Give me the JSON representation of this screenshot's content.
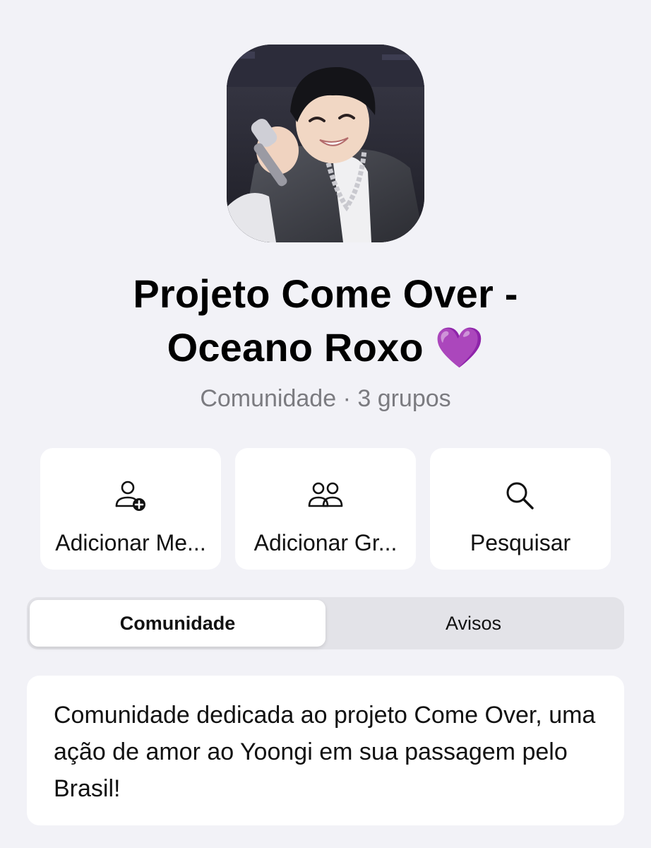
{
  "community": {
    "title_line1": "Projeto Come Over -",
    "title_line2": "Oceano Roxo",
    "title_emoji": "💜",
    "subtitle": "Comunidade · 3 grupos"
  },
  "actions": [
    {
      "label": "Adicionar Me...",
      "icon": "person-add-icon"
    },
    {
      "label": "Adicionar Gr...",
      "icon": "group-icon"
    },
    {
      "label": "Pesquisar",
      "icon": "search-icon"
    }
  ],
  "tabs": [
    {
      "label": "Comunidade",
      "selected": true
    },
    {
      "label": "Avisos",
      "selected": false
    }
  ],
  "description": "Comunidade dedicada ao projeto Come Over, uma ação de amor ao Yoongi em sua passagem pelo Brasil!",
  "colors": {
    "background": "#f2f2f7",
    "card": "#ffffff",
    "secondary_text": "#7b7b80",
    "heart": "#9b4dff"
  }
}
